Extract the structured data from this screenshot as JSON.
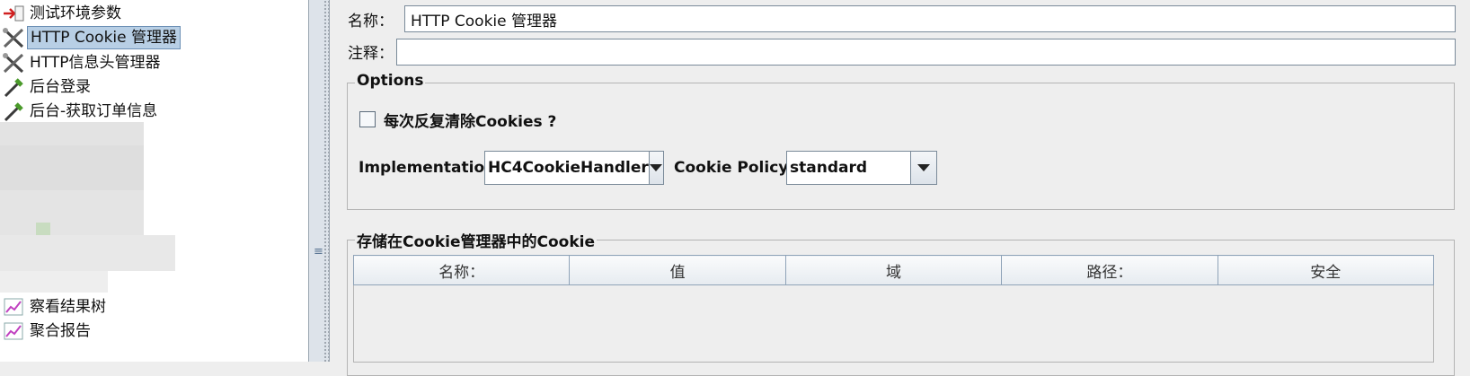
{
  "tree": {
    "items": [
      {
        "label": "测试环境参数",
        "icon": "arrow-config-icon"
      },
      {
        "label": "HTTP Cookie 管理器",
        "icon": "wrench-icon",
        "selected": true
      },
      {
        "label": "HTTP信息头管理器",
        "icon": "wrench-icon"
      },
      {
        "label": "后台登录",
        "icon": "pipette-icon"
      },
      {
        "label": "后台-获取订单信息",
        "icon": "pipette-icon"
      },
      {
        "label": "察看结果树",
        "icon": "graph-icon"
      },
      {
        "label": "聚合报告",
        "icon": "graph-icon"
      }
    ]
  },
  "form": {
    "name_label": "名称：",
    "name_value": "HTTP Cookie 管理器",
    "comment_label": "注释：",
    "comment_value": ""
  },
  "options": {
    "legend": "Options",
    "clear_each_iteration_label": "每次反复清除Cookies ?",
    "clear_each_iteration_checked": false,
    "implementation_label": "Implementation:",
    "implementation_value": "HC4CookieHandler",
    "policy_label": "Cookie Policy:",
    "policy_value": "standard"
  },
  "cookies": {
    "legend": "存储在Cookie管理器中的Cookie",
    "columns": [
      "名称：",
      "值",
      "域",
      "路径：",
      "安全"
    ],
    "rows": []
  }
}
